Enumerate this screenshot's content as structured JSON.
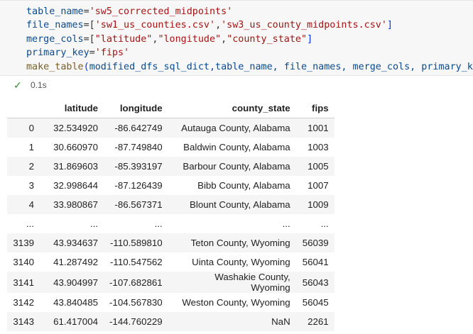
{
  "code": {
    "line1": {
      "var": "table_name",
      "op": "=",
      "val": "'sw5_corrected_midpoints'"
    },
    "line2": {
      "var": "file_names",
      "op": "=[",
      "v1": "'sw1_us_counties.csv'",
      "sep": ",",
      "v2": "'sw3_us_county_midpoints.csv'",
      "close": "]"
    },
    "line3": {
      "var": "merge_cols",
      "op": "=[",
      "v1": "\"latitude\"",
      "sep1": ",",
      "v2": "\"longitude\"",
      "sep2": ",",
      "v3": "\"county_state\"",
      "close": "]"
    },
    "line4": {
      "var": "primary_key",
      "op": "=",
      "val": "'fips'"
    },
    "line5": {
      "func": "make_table",
      "open": "(",
      "args": "modified_dfs_sql_dict,table_name, file_names, merge_cols, primary_key",
      "close": ")"
    }
  },
  "status": {
    "icon": "check-icon",
    "glyph": "✓",
    "time": "0.1s"
  },
  "table": {
    "headers": [
      "",
      "latitude",
      "longitude",
      "county_state",
      "fips"
    ],
    "rows": [
      [
        "0",
        "32.534920",
        "-86.642749",
        "Autauga County, Alabama",
        "1001"
      ],
      [
        "1",
        "30.660970",
        "-87.749840",
        "Baldwin County, Alabama",
        "1003"
      ],
      [
        "2",
        "31.869603",
        "-85.393197",
        "Barbour County, Alabama",
        "1005"
      ],
      [
        "3",
        "32.998644",
        "-87.126439",
        "Bibb County, Alabama",
        "1007"
      ],
      [
        "4",
        "33.980867",
        "-86.567371",
        "Blount County, Alabama",
        "1009"
      ],
      [
        "...",
        "...",
        "...",
        "...",
        "..."
      ],
      [
        "3139",
        "43.934637",
        "-110.589810",
        "Teton County, Wyoming",
        "56039"
      ],
      [
        "3140",
        "41.287492",
        "-110.547562",
        "Uinta County, Wyoming",
        "56041"
      ],
      [
        "3141",
        "43.904997",
        "-107.682861",
        "Washakie County, Wyoming",
        "56043"
      ],
      [
        "3142",
        "43.840485",
        "-104.567830",
        "Weston County, Wyoming",
        "56045"
      ],
      [
        "3143",
        "61.417004",
        "-144.760229",
        "NaN",
        "2261"
      ]
    ]
  }
}
